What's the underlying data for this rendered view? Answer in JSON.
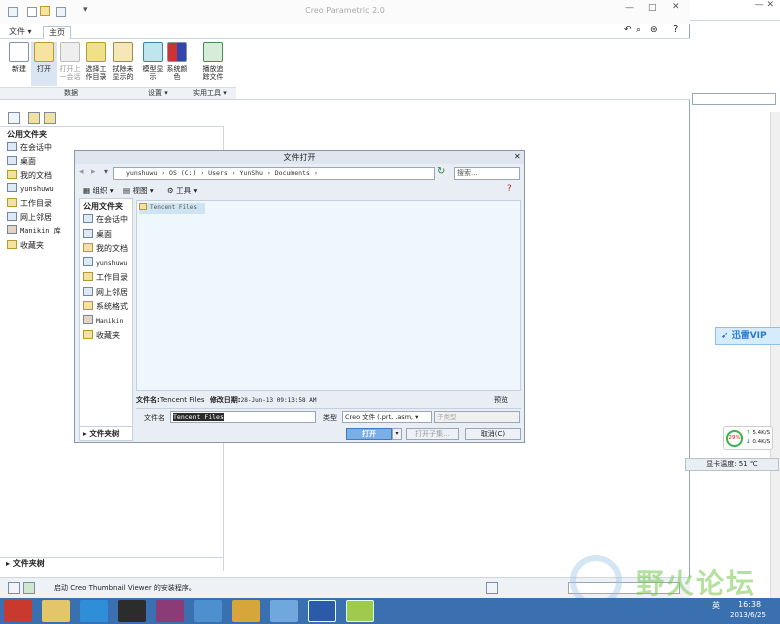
{
  "app": {
    "title": "Creo Parametric 2.0"
  },
  "tabs": {
    "file": "文件",
    "home": "主页"
  },
  "ribbon": {
    "buttons": [
      "新建",
      "打开",
      "打开上一会话",
      "选择工作目录",
      "拭除未显示的",
      "模型显示",
      "系统颜色",
      "播放追踪文件"
    ],
    "groups": {
      "data": "数据",
      "settings": "设置",
      "utilities": "实用工具"
    }
  },
  "left_panel": {
    "header": "公用文件夹",
    "items": [
      "在会话中",
      "桌面",
      "我的文档",
      "yunshuwu",
      "工作目录",
      "网上邻居",
      "Manikin 库",
      "收藏夹"
    ],
    "footer": "文件夹树"
  },
  "status": {
    "message": "启动 Creo Thumbnail Viewer 的安装程序。"
  },
  "dialog": {
    "title": "文件打开",
    "address": "yunshuwu › OS (C:) › Users › YunShu › Documents ›",
    "search_placeholder": "搜索...",
    "toolbar": {
      "organize": "组织",
      "view": "视图",
      "tools": "工具"
    },
    "side_header": "公用文件夹",
    "side_items": [
      "在会话中",
      "桌面",
      "我的文档",
      "yunshuwu",
      "工作目录",
      "网上邻居",
      "系统格式",
      "Manikin 库",
      "收藏夹"
    ],
    "side_footer": "文件夹树",
    "files": [
      "Tencent Files"
    ],
    "info": {
      "name_label": "文件名:",
      "name_value": "Tencent Files",
      "date_label": "修改日期:",
      "date_value": "28-Jun-13 09:13:58 AM",
      "preview": "预览"
    },
    "filename_label": "文件名",
    "filename_value": "Tencent Files",
    "type_label": "类型",
    "type_value": "Creo 文件 (.prt, .asm,",
    "subtype_placeholder": "子类型",
    "buttons": {
      "open": "打开",
      "open_sub": "打开子集...",
      "cancel": "取消(C)"
    }
  },
  "right_window": {
    "vip": "迅雷VIP",
    "net_percent": "29%",
    "up": "5.4K/S",
    "down": "0.4K/S",
    "gpu_temp": "显卡温度: 51 ℃"
  },
  "watermark": {
    "text": "野火论坛"
  },
  "taskbar": {
    "time": "16:38",
    "date": "2013/6/25",
    "lang": "英"
  },
  "colors": {
    "accent": "#3a6fb0",
    "dialog_bg": "#e9eef5",
    "list_bg": "#eef7fb"
  }
}
